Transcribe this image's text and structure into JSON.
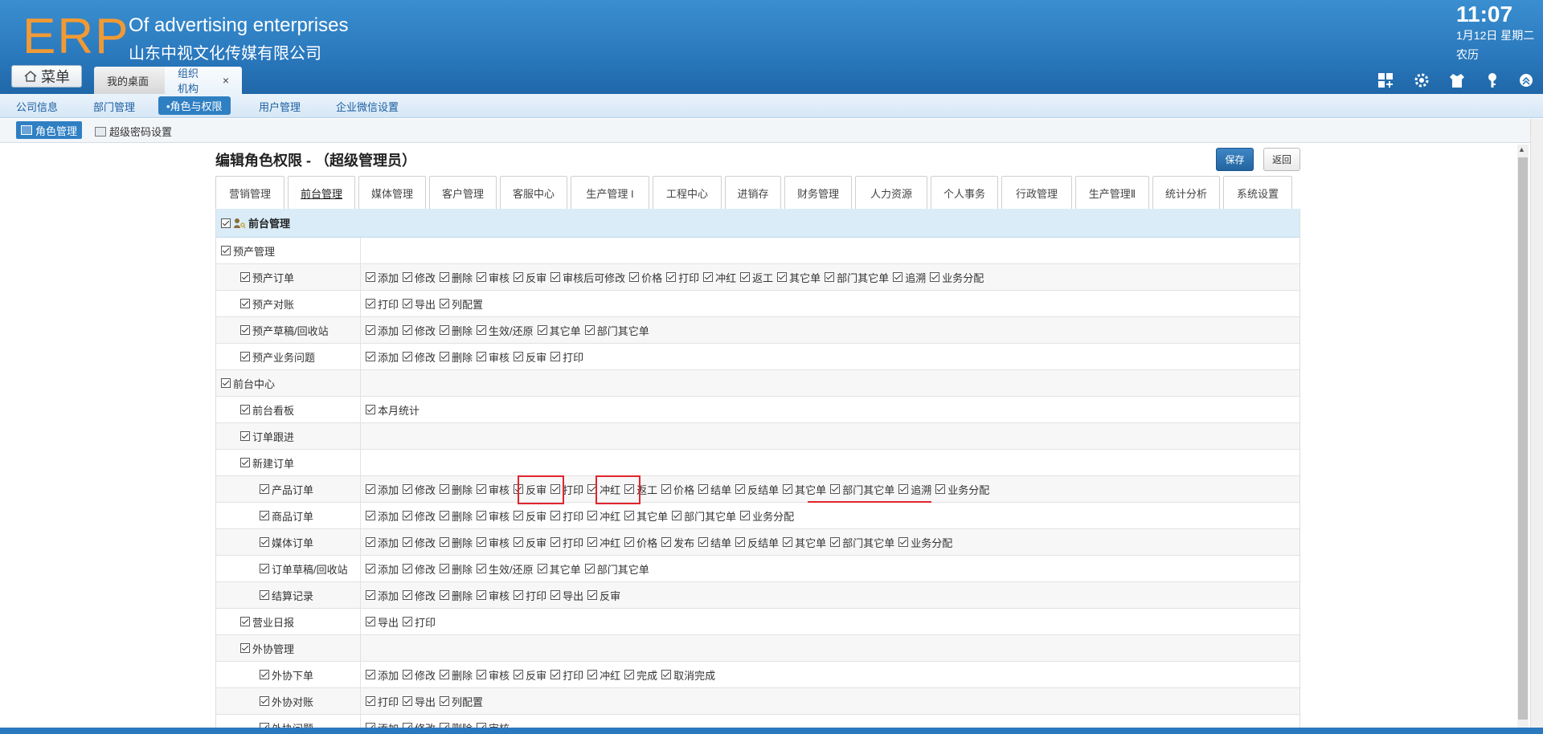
{
  "header": {
    "logo": "ERP",
    "company_en": "Of advertising enterprises",
    "company_cn": "山东中视文化传媒有限公司",
    "time": "11:07",
    "date": "1月12日 星期二",
    "lunar": "农历"
  },
  "menu_button": "菜单",
  "top_tabs": [
    {
      "label": "我的桌面"
    },
    {
      "label": "组织机构",
      "close": "×"
    }
  ],
  "subnav": [
    "公司信息",
    "部门管理",
    "•角色与权限",
    "用户管理",
    "企业微信设置"
  ],
  "subsub": {
    "role_mgmt": "角色管理",
    "super_pwd": "超级密码设置"
  },
  "page": {
    "title": "编辑角色权限 - （超级管理员）",
    "save": "保存",
    "back": "返回"
  },
  "module_tabs": [
    "营销管理",
    "前台管理",
    "媒体管理",
    "客户管理",
    "客服中心",
    "生产管理 I",
    "工程中心",
    "进销存",
    "财务管理",
    "人力资源",
    "个人事务",
    "行政管理",
    "生产管理Ⅱ",
    "统计分析",
    "系统设置"
  ],
  "active_module": "前台管理",
  "section_title": "前台管理",
  "rows": [
    {
      "level": 1,
      "name": "预产管理",
      "perms": []
    },
    {
      "level": 2,
      "name": "预产订单",
      "perms": [
        "添加",
        "修改",
        "删除",
        "审核",
        "反审",
        "审核后可修改",
        "价格",
        "打印",
        "冲红",
        "返工",
        "其它单",
        "部门其它单",
        "追溯",
        "业务分配"
      ]
    },
    {
      "level": 2,
      "name": "预产对账",
      "perms": [
        "打印",
        "导出",
        "列配置"
      ]
    },
    {
      "level": 2,
      "name": "预产草稿/回收站",
      "perms": [
        "添加",
        "修改",
        "删除",
        "生效/还原",
        "其它单",
        "部门其它单"
      ]
    },
    {
      "level": 2,
      "name": "预产业务问题",
      "perms": [
        "添加",
        "修改",
        "删除",
        "审核",
        "反审",
        "打印"
      ]
    },
    {
      "level": 1,
      "name": "前台中心",
      "perms": []
    },
    {
      "level": 2,
      "name": "前台看板",
      "perms": [
        "本月统计"
      ]
    },
    {
      "level": 2,
      "name": "订单跟进",
      "perms": []
    },
    {
      "level": 2,
      "name": "新建订单",
      "perms": []
    },
    {
      "level": 3,
      "name": "产品订单",
      "perms": [
        "添加",
        "修改",
        "删除",
        "审核",
        "反审",
        "打印",
        "冲红",
        "返工",
        "价格",
        "结单",
        "反结单",
        "其它单",
        "部门其它单",
        "追溯",
        "业务分配"
      ]
    },
    {
      "level": 3,
      "name": "商品订单",
      "perms": [
        "添加",
        "修改",
        "删除",
        "审核",
        "反审",
        "打印",
        "冲红",
        "其它单",
        "部门其它单",
        "业务分配"
      ]
    },
    {
      "level": 3,
      "name": "媒体订单",
      "perms": [
        "添加",
        "修改",
        "删除",
        "审核",
        "反审",
        "打印",
        "冲红",
        "价格",
        "发布",
        "结单",
        "反结单",
        "其它单",
        "部门其它单",
        "业务分配"
      ]
    },
    {
      "level": 3,
      "name": "订单草稿/回收站",
      "perms": [
        "添加",
        "修改",
        "删除",
        "生效/还原",
        "其它单",
        "部门其它单"
      ]
    },
    {
      "level": 3,
      "name": "结算记录",
      "perms": [
        "添加",
        "修改",
        "删除",
        "审核",
        "打印",
        "导出",
        "反审"
      ]
    },
    {
      "level": 2,
      "name": "营业日报",
      "perms": [
        "导出",
        "打印"
      ]
    },
    {
      "level": 2,
      "name": "外协管理",
      "perms": []
    },
    {
      "level": 3,
      "name": "外协下单",
      "perms": [
        "添加",
        "修改",
        "删除",
        "审核",
        "反审",
        "打印",
        "冲红",
        "完成",
        "取消完成"
      ]
    },
    {
      "level": 3,
      "name": "外协对账",
      "perms": [
        "打印",
        "导出",
        "列配置"
      ]
    },
    {
      "level": 3,
      "name": "外协问题",
      "perms": [
        "添加",
        "修改",
        "删除",
        "审核"
      ]
    }
  ],
  "colors": {
    "header": "#2a78bd",
    "logo": "#f19a35",
    "accent": "#2f7fc3",
    "section_bg": "#d9ecf7",
    "annotation": "#e0262e"
  }
}
